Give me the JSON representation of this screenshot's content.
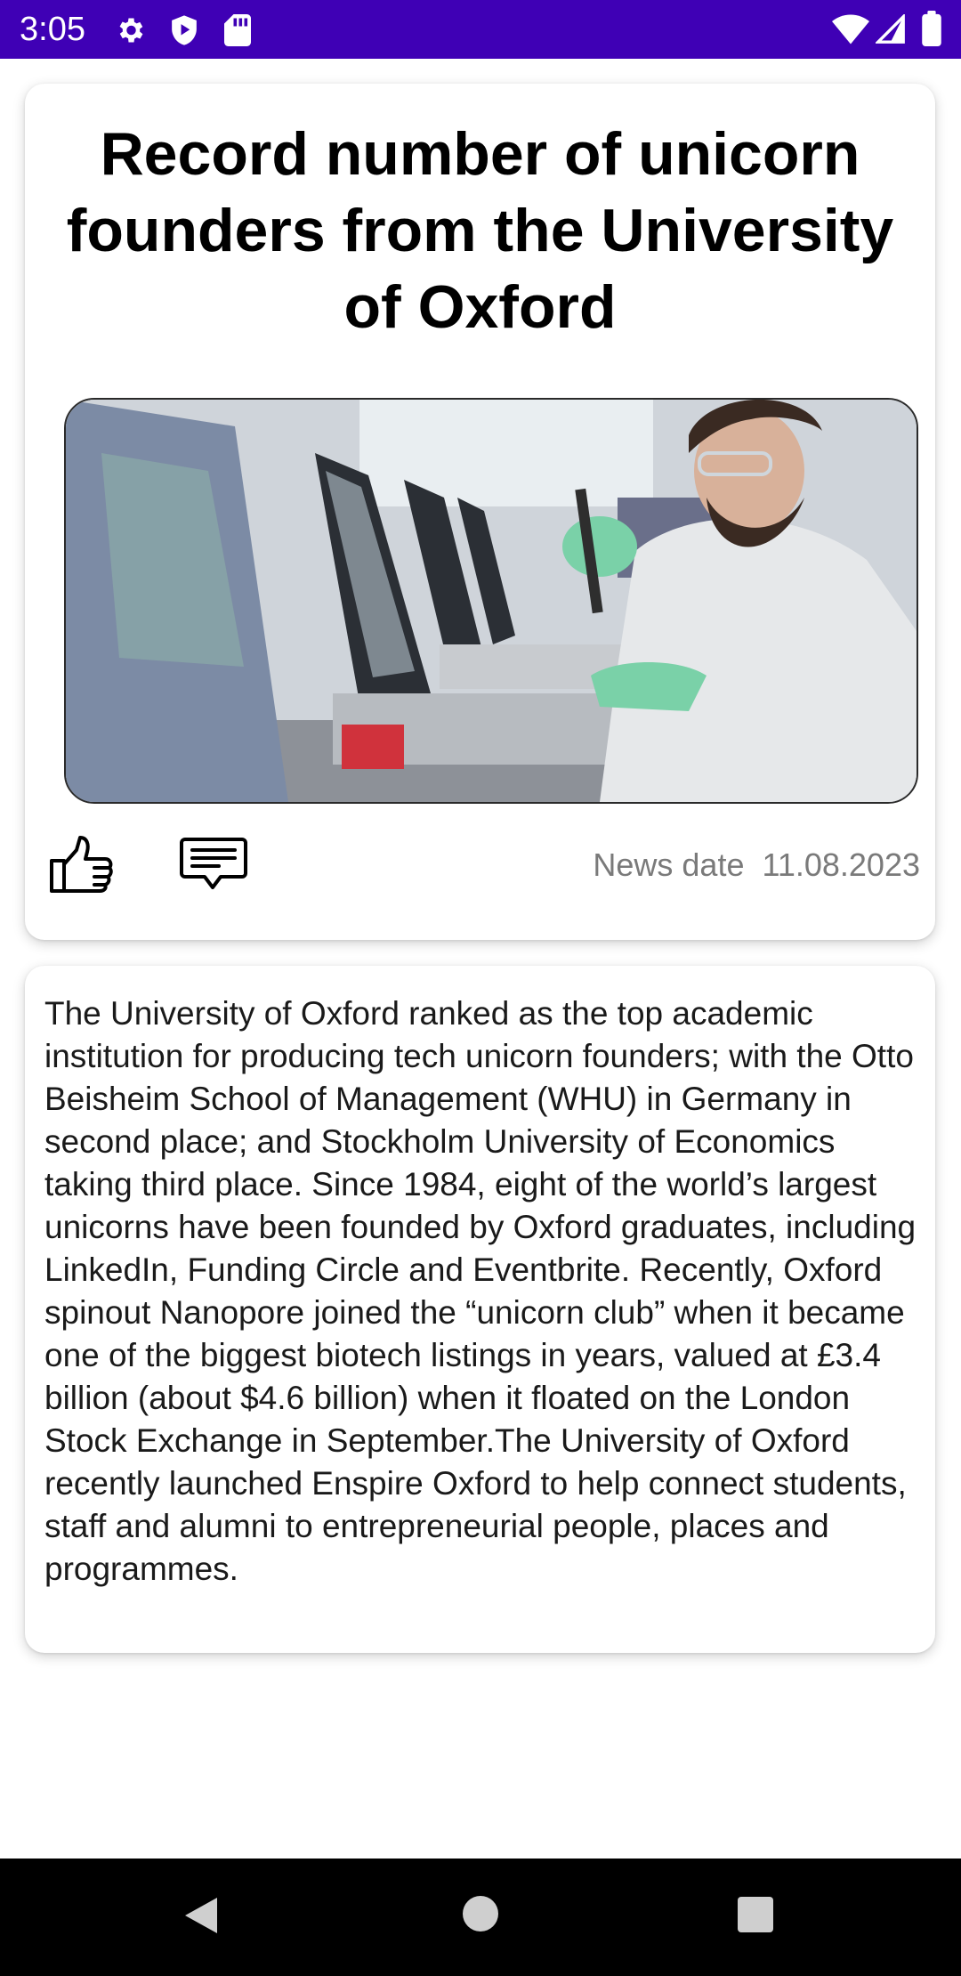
{
  "status_bar": {
    "time": "3:05",
    "icons": [
      "gear-icon",
      "play-protect-icon",
      "sd-card-icon",
      "wifi-icon",
      "signal-icon",
      "battery-icon"
    ],
    "background": "#3f00b5"
  },
  "article": {
    "title": "Record number of unicorn founders from the University of Oxford",
    "image": "lab-researcher-pipette-photo",
    "actions": {
      "like_icon": "thumbs-up-icon",
      "comment_icon": "comment-icon"
    },
    "date_label": "News date",
    "date_value": "11.08.2023",
    "body": "The University of Oxford ranked as the top academic institution for producing tech unicorn founders; with the Otto Beisheim School of Management (WHU) in Germany in second place; and Stockholm University of Economics taking third place.  Since 1984, eight of the world’s largest unicorns have been founded by Oxford graduates, including LinkedIn, Funding Circle and Eventbrite. Recently, Oxford spinout Nanopore joined the “unicorn club” when it became one of the biggest biotech listings in years, valued at £3.4 billion (about $4.6 billion) when it floated on the London Stock Exchange in September.The University of Oxford recently launched Enspire Oxford to help connect students, staff and alumni to entrepreneurial people, places and programmes."
  },
  "nav_bar": {
    "buttons": [
      "back-icon",
      "home-icon",
      "recents-icon"
    ],
    "background": "#000000"
  }
}
